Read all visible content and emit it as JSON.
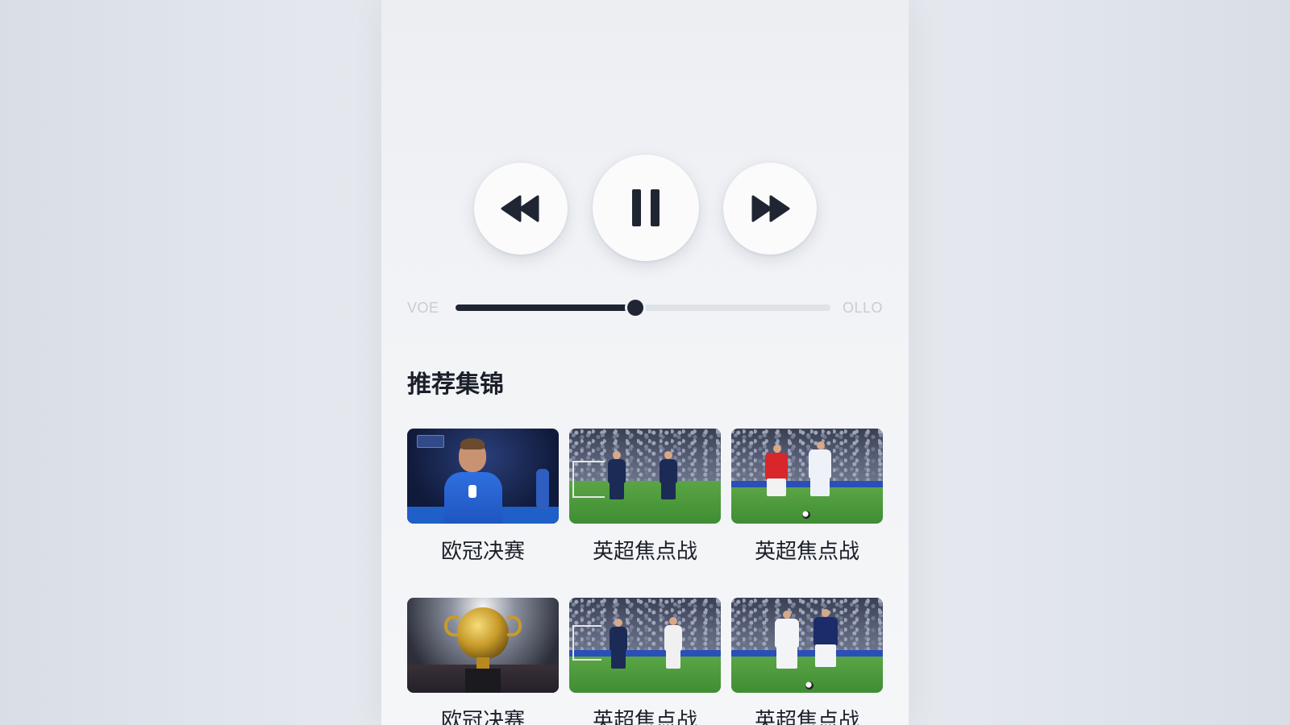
{
  "player": {
    "time_elapsed": "VOE",
    "time_total": "OLLO",
    "progress_fraction": 0.48
  },
  "section": {
    "title": "推荐集锦"
  },
  "highlights": [
    {
      "label": "欧冠决赛",
      "scene": "portrait-blue"
    },
    {
      "label": "英超焦点战",
      "scene": "two-navy"
    },
    {
      "label": "英超焦点战",
      "scene": "red-vs-white"
    },
    {
      "label": "欧冠决赛",
      "scene": "trophy"
    },
    {
      "label": "英超焦点战",
      "scene": "navy-vs-white"
    },
    {
      "label": "英超焦点战",
      "scene": "white-vs-navy"
    }
  ],
  "icons": {
    "rewind": "rewind-icon",
    "pause": "pause-icon",
    "forward": "fast-forward-icon"
  },
  "colors": {
    "accent": "#1f2533",
    "track": "#dfe2e7",
    "background": "#f1f3f6"
  }
}
